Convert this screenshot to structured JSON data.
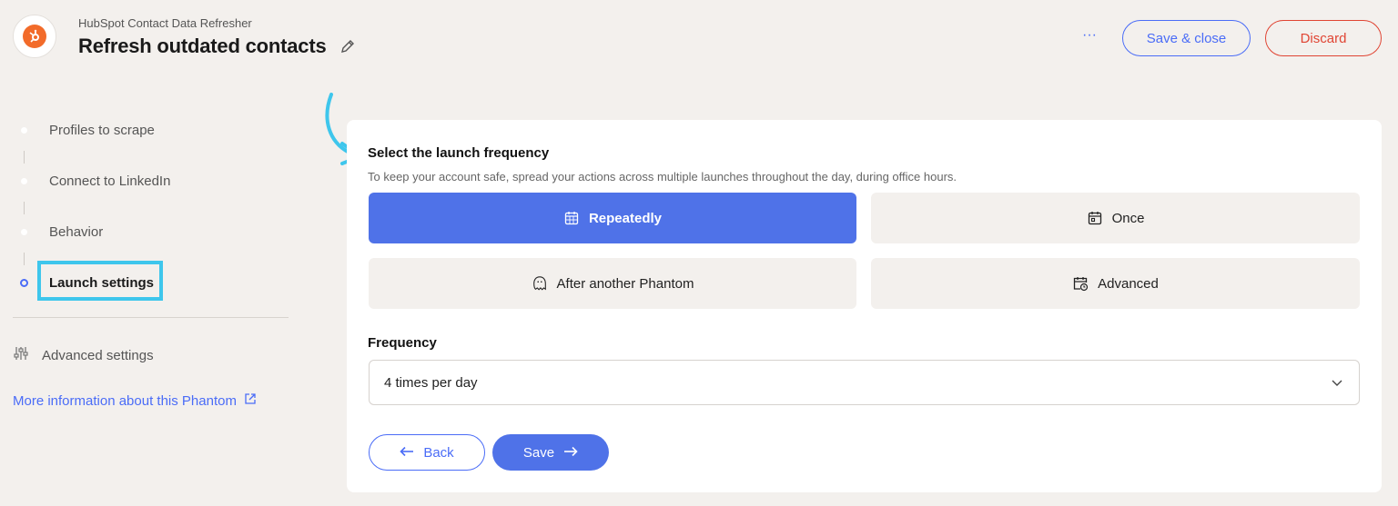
{
  "header": {
    "app_name": "HubSpot Contact Data Refresher",
    "title": "Refresh outdated contacts",
    "more_label": "···",
    "save_close_label": "Save & close",
    "discard_label": "Discard"
  },
  "sidebar": {
    "steps": [
      {
        "label": "Profiles to scrape",
        "active": false
      },
      {
        "label": "Connect to LinkedIn",
        "active": false
      },
      {
        "label": "Behavior",
        "active": false
      },
      {
        "label": "Launch settings",
        "active": true
      }
    ],
    "advanced_settings_label": "Advanced settings",
    "more_info_label": "More information about this Phantom"
  },
  "main": {
    "section_title": "Select the launch frequency",
    "section_desc": "To keep your account safe, spread your actions across multiple launches throughout the day, during office hours.",
    "options": [
      {
        "label": "Repeatedly",
        "icon": "calendar-grid-icon",
        "selected": true
      },
      {
        "label": "Once",
        "icon": "calendar-icon",
        "selected": false
      },
      {
        "label": "After another Phantom",
        "icon": "ghost-icon",
        "selected": false
      },
      {
        "label": "Advanced",
        "icon": "calendar-clock-icon",
        "selected": false
      }
    ],
    "frequency_label": "Frequency",
    "frequency_value": "4 times per day",
    "back_label": "Back",
    "save_label": "Save"
  },
  "colors": {
    "accent": "#4f72e8",
    "link": "#4a6cf7",
    "danger": "#e04433",
    "highlight": "#3ec6ec",
    "brand": "#f26b2a"
  }
}
